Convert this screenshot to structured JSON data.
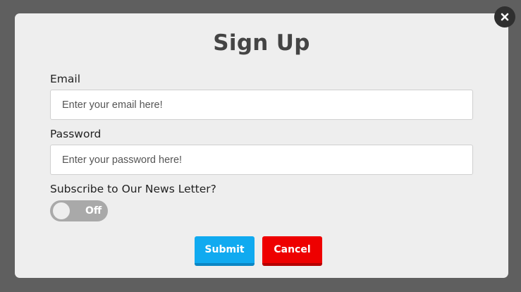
{
  "modal": {
    "title": "Sign Up",
    "close_icon": "close-icon"
  },
  "form": {
    "email": {
      "label": "Email",
      "placeholder": "Enter your email here!",
      "value": ""
    },
    "password": {
      "label": "Password",
      "placeholder": "Enter your password here!",
      "value": ""
    },
    "subscribe": {
      "label": "Subscribe to Our News Letter?",
      "toggle_text": "Off",
      "toggle_state": false
    }
  },
  "actions": {
    "submit_label": "Submit",
    "cancel_label": "Cancel"
  },
  "colors": {
    "overlay": "#5f5f5f",
    "modal_bg": "#eeeeee",
    "submit": "#10aaf0",
    "cancel": "#ee0000",
    "toggle_off": "#a9a9a9"
  }
}
